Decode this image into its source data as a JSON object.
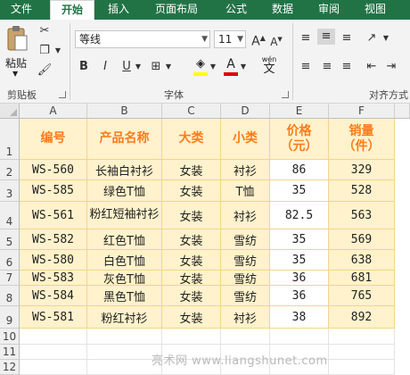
{
  "tabs": [
    "文件",
    "开始",
    "插入",
    "页面布局",
    "公式",
    "数据",
    "审阅",
    "视图"
  ],
  "active_tab": "开始",
  "ribbon": {
    "paste_label": "粘贴",
    "clipboard_label": "剪贴板",
    "font_group_label": "字体",
    "align_group_label": "对齐方式",
    "font_name": "等线",
    "font_size": "11",
    "bold": "B",
    "italic": "I",
    "underline": "U",
    "wen": "wén"
  },
  "columns": [
    "A",
    "B",
    "C",
    "D",
    "E",
    "F"
  ],
  "rows": [
    "1",
    "2",
    "3",
    "4",
    "5",
    "6",
    "7",
    "8",
    "9",
    "10",
    "11",
    "12"
  ],
  "headers": [
    "编号",
    "产品名称",
    "大类",
    "小类",
    "价格\n（元）",
    "销量\n（件）"
  ],
  "table": [
    [
      "WS-560",
      "长袖白衬衫",
      "女装",
      "衬衫",
      "86",
      "329"
    ],
    [
      "WS-585",
      "绿色T恤",
      "女装",
      "T恤",
      "35",
      "528"
    ],
    [
      "WS-561",
      "粉红短袖衬衫",
      "女装",
      "衬衫",
      "82.5",
      "563"
    ],
    [
      "WS-582",
      "红色T恤",
      "女装",
      "雪纺",
      "35",
      "569"
    ],
    [
      "WS-580",
      "白色T恤",
      "女装",
      "雪纺",
      "35",
      "638"
    ],
    [
      "WS-583",
      "灰色T恤",
      "女装",
      "雪纺",
      "36",
      "681"
    ],
    [
      "WS-584",
      "黑色T恤",
      "女装",
      "雪纺",
      "36",
      "765"
    ],
    [
      "WS-581",
      "粉红衬衫",
      "女装",
      "衬衫",
      "38",
      "892"
    ]
  ],
  "watermark": "亮术网 www.liangshunet.com",
  "colors": {
    "ribbon_green": "#217346",
    "header_text": "#ff7b1c",
    "header_fill": "#fff2cc",
    "data_fill": "#fff2cc",
    "border": "#f2d58a"
  }
}
